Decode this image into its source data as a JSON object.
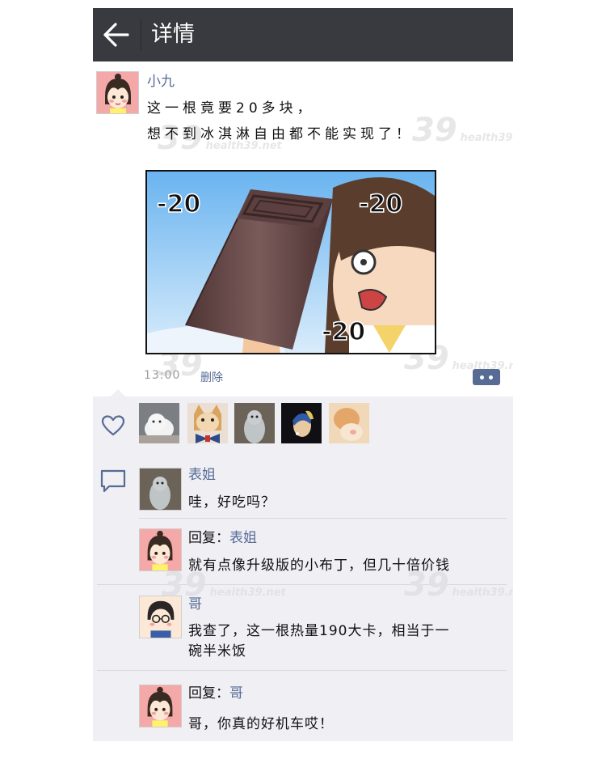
{
  "header": {
    "title": "详情",
    "back_icon": "arrow-left-icon"
  },
  "post": {
    "author": "小九",
    "text_line1": "这一根竟要20多块，",
    "text_line2": "想不到冰淇淋自由都不能实现了！",
    "image_labels": [
      "-20",
      "-20",
      "-20"
    ],
    "time": "13:00",
    "delete_label": "删除"
  },
  "likes": {
    "icon": "heart-icon",
    "count_shown": 5
  },
  "comments": [
    {
      "name": "表姐",
      "reply_prefix": "",
      "text": "哇，好吃吗？"
    },
    {
      "name": "表姐",
      "reply_prefix": "回复：",
      "text": "就有点像升级版的小布丁，但几十倍价钱"
    },
    {
      "name": "哥",
      "reply_prefix": "",
      "text": "我查了，这一根热量190大卡，相当于一",
      "text2": "碗半米饭"
    },
    {
      "name": "哥",
      "reply_prefix": "回复：",
      "text": "哥，你真的好机车哎！"
    }
  ],
  "watermark": {
    "logo": "39",
    "brand": "健康网",
    "site": "health39.net"
  },
  "colors": {
    "topbar": "#393a3f",
    "link": "#576b95",
    "panel": "#efeff4"
  }
}
